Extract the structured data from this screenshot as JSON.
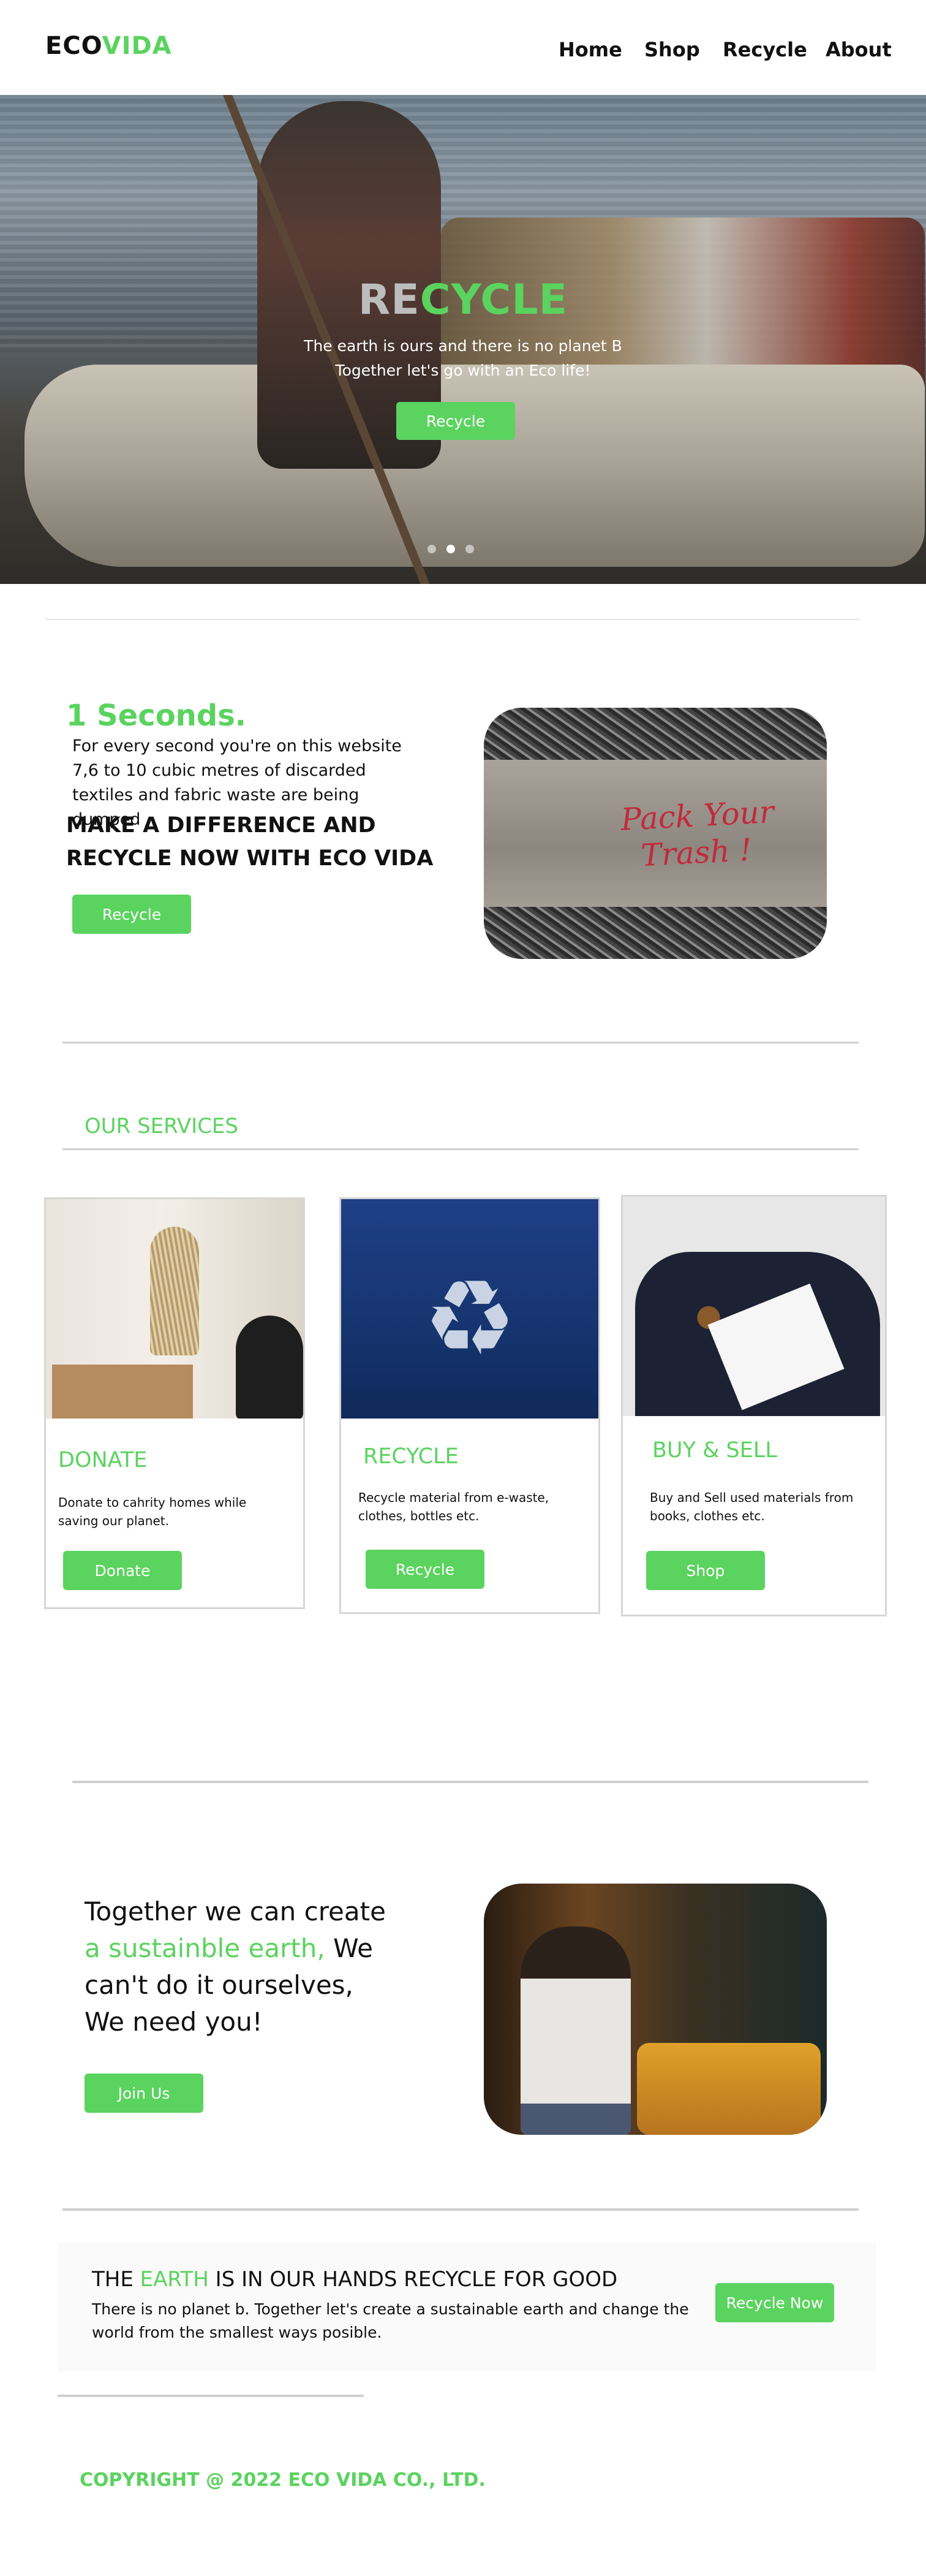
{
  "header": {
    "logo_eco": "ECO",
    "logo_vida": "VIDA",
    "nav": [
      "Home",
      "Shop",
      "Recycle",
      "About"
    ]
  },
  "hero": {
    "title_re": "RE",
    "title_cycle": "CYCLE",
    "subtitle_line1": "The earth is ours and there is no planet B",
    "subtitle_line2": "Together let's go with an Eco life!",
    "button": "Recycle",
    "slide_count": 3
  },
  "intro": {
    "count": "1 Seconds.",
    "text": "For every second you're on this website 7,6 to 10 cubic metres of discarded textiles and fabric waste are being dumped",
    "heading_line1": "MAKE A DIFFERENCE AND",
    "heading_line2": "RECYCLE NOW WITH ECO VIDA",
    "button": "Recycle",
    "image_sign_line1": "Pack Your",
    "image_sign_line2": "Trash !"
  },
  "services": {
    "title": "OUR SERVICES",
    "cards": [
      {
        "title": "DONATE",
        "text": "Donate to cahrity homes while saving our planet.",
        "button": "Donate"
      },
      {
        "title": "RECYCLE",
        "text": "Recycle material from e-waste, clothes, bottles etc.",
        "button": "Recycle"
      },
      {
        "title": "BUY & SELL",
        "text": "Buy and Sell used materials from books, clothes etc.",
        "button": "Shop"
      }
    ]
  },
  "together": {
    "line1": "Together we can create",
    "highlight": "a sustainble earth,",
    "line2_rest": " We",
    "line3": "can't do it ourselves,",
    "line4": "We need you!",
    "button": "Join Us"
  },
  "banner": {
    "title_pre": "THE ",
    "title_highlight": "EARTH",
    "title_post": " IS IN OUR HANDS RECYCLE FOR GOOD",
    "text": "There is no planet b. Together let's create a sustainable earth and change the world from the smallest ways posible.",
    "button": "Recycle Now"
  },
  "footer": {
    "copyright": "COPYRIGHT @ 2022 ECO VIDA CO., LTD."
  },
  "colors": {
    "accent": "#5bd35f",
    "divider": "#cfcfcf"
  }
}
